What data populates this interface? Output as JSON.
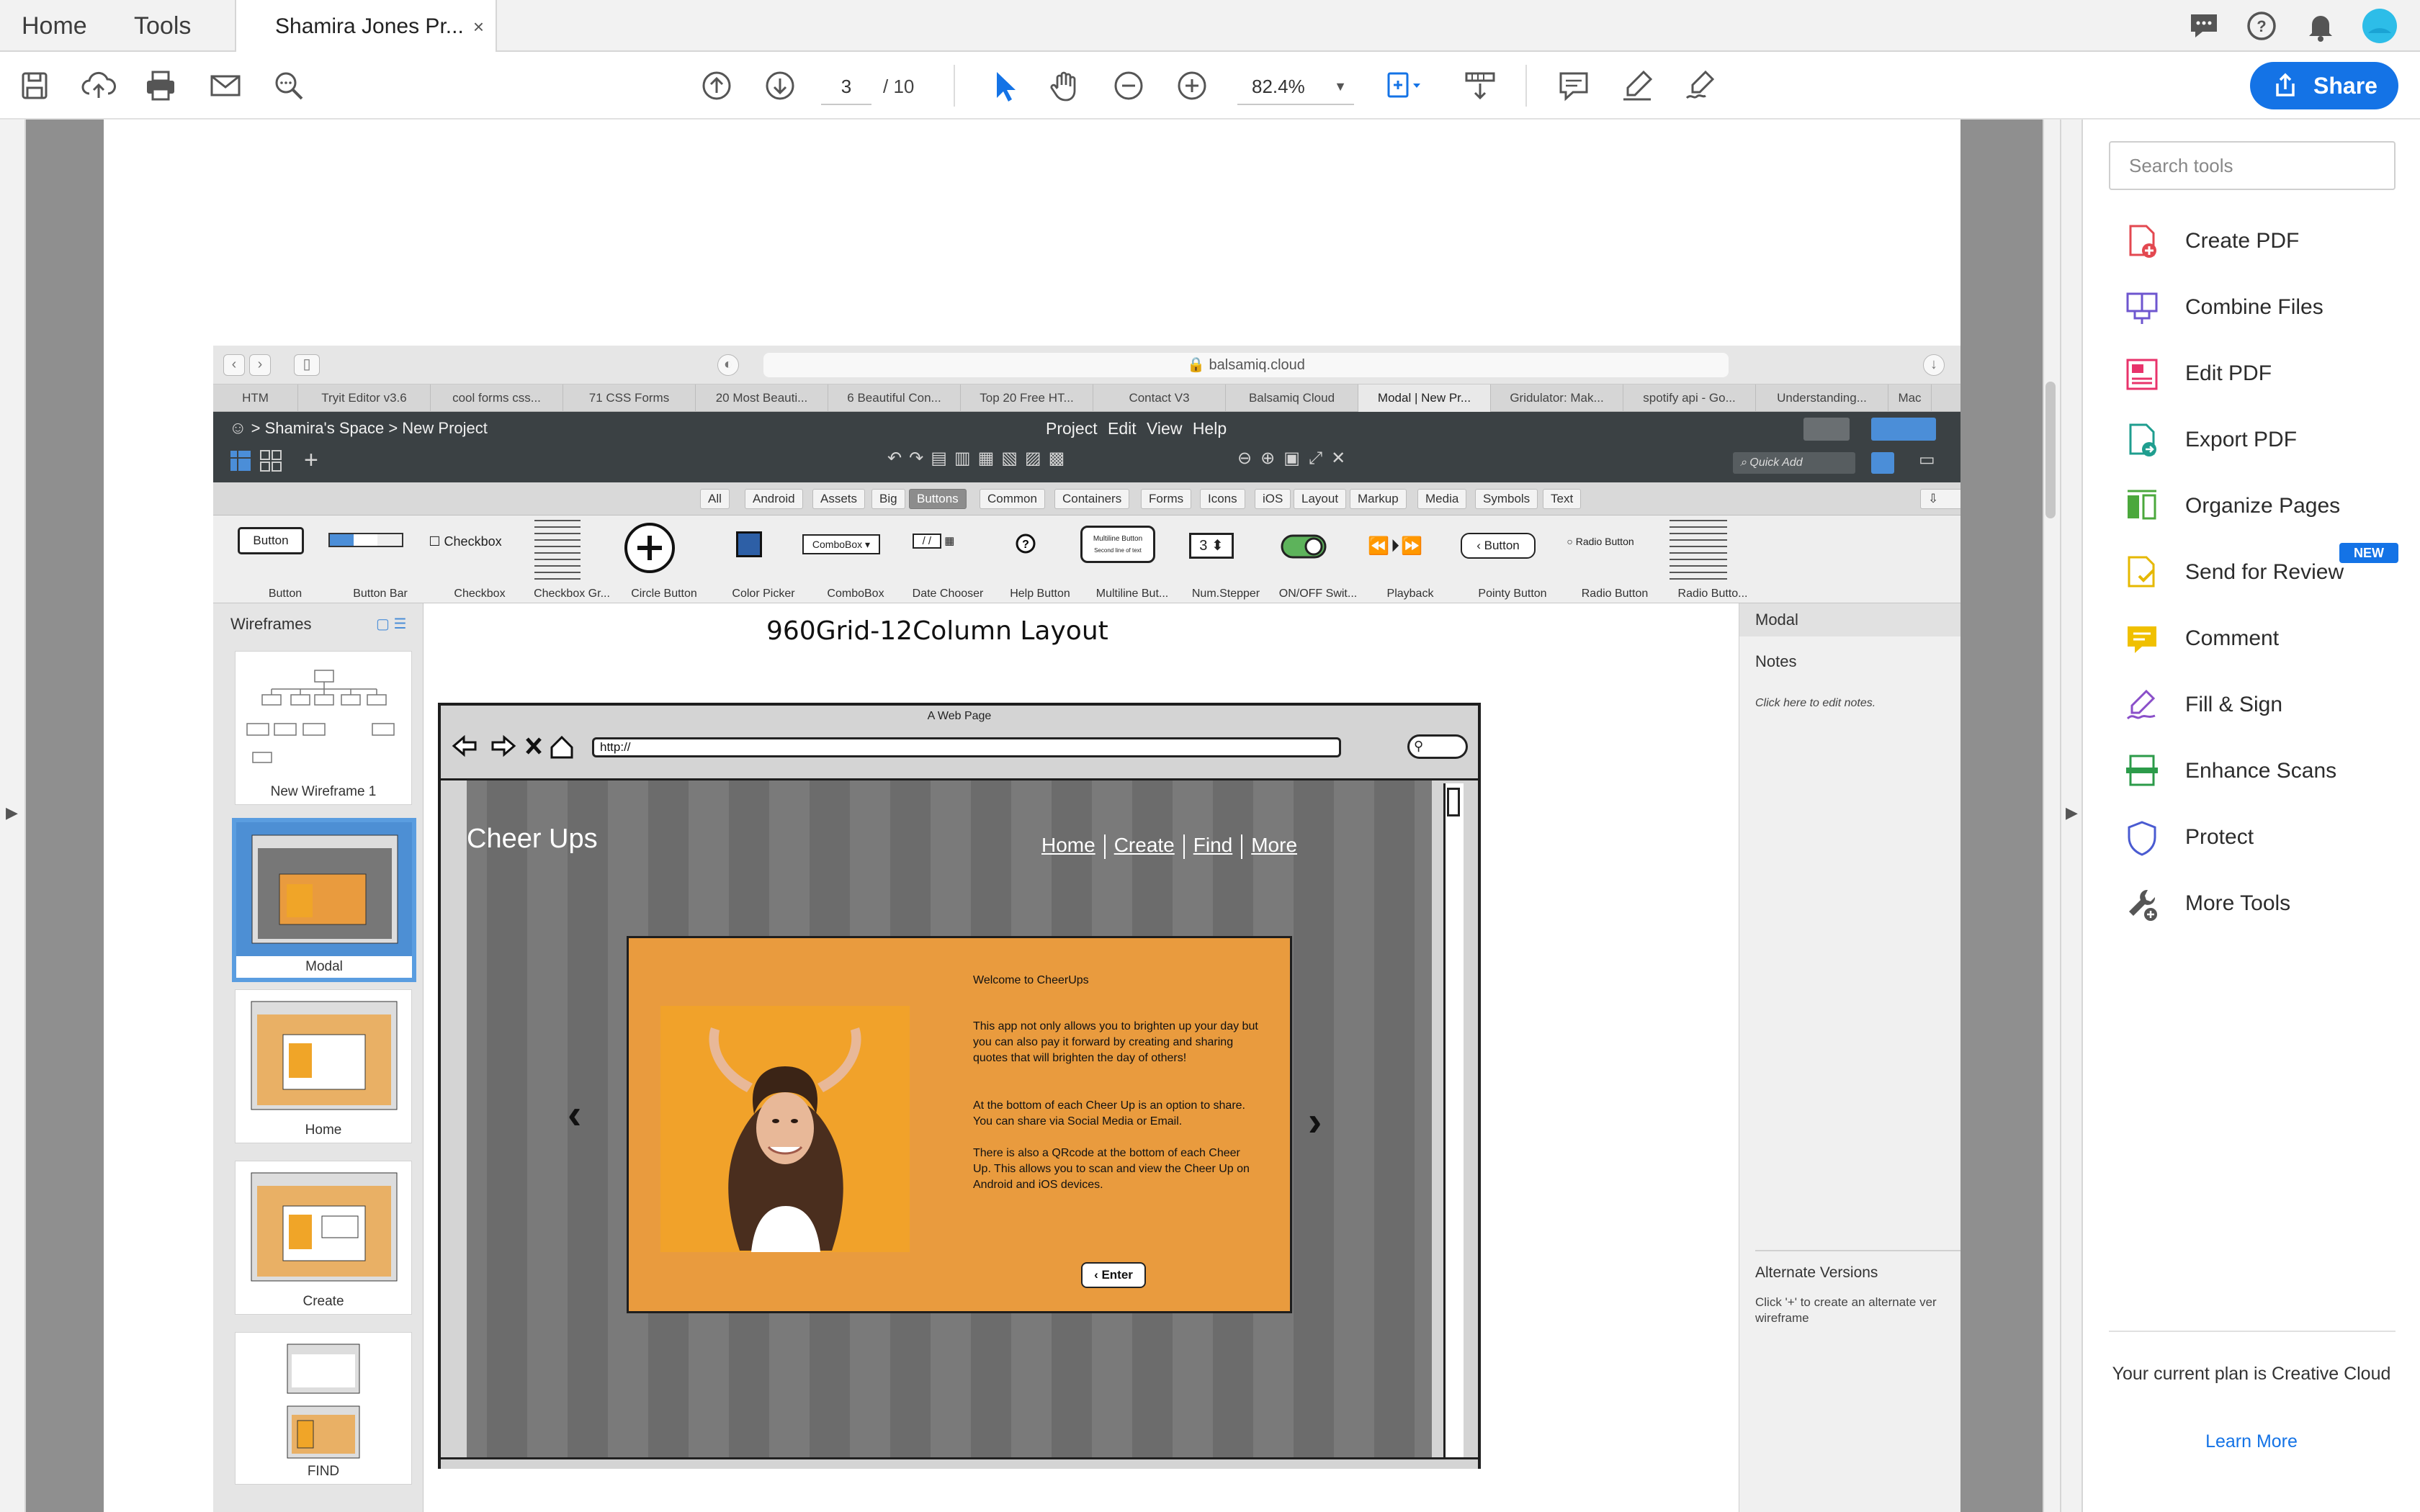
{
  "app": {
    "tabs": {
      "home": "Home",
      "tools": "Tools"
    },
    "document_tab": {
      "title": "Shamira Jones Pr...",
      "close": "×"
    },
    "header_icons": [
      "chat-icon",
      "help-icon",
      "bell-icon",
      "profile-avatar"
    ]
  },
  "toolbar": {
    "page_current": "3",
    "page_total": "/ 10",
    "zoom": "82.4%",
    "share_label": "Share"
  },
  "browser": {
    "url": "balsamiq.cloud",
    "tabs": [
      "HTM",
      "Tryit Editor v3.6",
      "cool forms css...",
      "71 CSS Forms",
      "20 Most Beauti...",
      "6 Beautiful Con...",
      "Top 20 Free HT...",
      "Contact V3",
      "Balsamiq Cloud",
      "Modal | New Pr...",
      "Gridulator: Mak...",
      "spotify api - Go...",
      "Understanding...",
      "Mac"
    ]
  },
  "balsamiq": {
    "breadcrumb": "> Shamira's Space > New Project",
    "menu": "Project Edit View Help",
    "quick_add": "Quick Add",
    "filters": [
      "All",
      "Android",
      "Assets",
      "Big",
      "Buttons",
      "Common",
      "Containers",
      "Forms",
      "Icons",
      "iOS",
      "Layout",
      "Markup",
      "Media",
      "Symbols",
      "Text"
    ],
    "filter_active": "Buttons",
    "library": [
      "Button",
      "Button Bar",
      "Checkbox",
      "Checkbox Gr...",
      "Circle Button",
      "Color Picker",
      "ComboBox",
      "Date Chooser",
      "Help Button",
      "Multiline But...",
      "Num.Stepper",
      "ON/OFF Swit...",
      "Playback",
      "Pointy Button",
      "Radio Button",
      "Radio Butto..."
    ],
    "library_widgets": {
      "button": "Button",
      "checkbox": "Checkbox",
      "combobox": "ComboBox",
      "date": "/ /",
      "multiline": "Multiline Button",
      "multiline_sub": "Second line of text",
      "stepper": "3",
      "pointy": "Button",
      "radio": "Radio Button"
    },
    "wireframes_header": "Wireframes",
    "wireframes": [
      "New Wireframe 1",
      "Modal",
      "Home",
      "Create",
      "FIND"
    ],
    "selected_wireframe": "Modal",
    "inspector": {
      "title": "Modal",
      "notes_title": "Notes",
      "notes_hint": "Click here to edit notes.",
      "alt_title": "Alternate Versions",
      "alt_text": "Click '+' to create an alternate ver wireframe"
    }
  },
  "mockup": {
    "title": "960Grid-12Column Layout",
    "window_title": "A Web Page",
    "url": "http://",
    "brand": "Cheer Ups",
    "nav": [
      "Home",
      "Create",
      "Find",
      "More"
    ],
    "modal": {
      "heading": "Welcome to CheerUps",
      "p1": "This app not only allows you to brighten up your day but you can also pay it forward by creating and sharing quotes that will brighten the day of others!",
      "p2": "At the bottom of each Cheer Up is an option to share. You can share via Social Media or Email.",
      "p3": "There is also a QRcode at the bottom of each Cheer Up. This allows you to scan and view the Cheer Up on Android and iOS devices.",
      "enter": "Enter"
    },
    "carousel": {
      "prev": "‹",
      "next": "›"
    }
  },
  "tools_pane": {
    "search_placeholder": "Search tools",
    "tools": [
      {
        "label": "Create PDF",
        "icon": "create-pdf-icon",
        "color": "#e34850"
      },
      {
        "label": "Combine Files",
        "icon": "combine-files-icon",
        "color": "#6e56cf"
      },
      {
        "label": "Edit PDF",
        "icon": "edit-pdf-icon",
        "color": "#e8336b"
      },
      {
        "label": "Export PDF",
        "icon": "export-pdf-icon",
        "color": "#1f9e8f"
      },
      {
        "label": "Organize Pages",
        "icon": "organize-pages-icon",
        "color": "#4ba83c"
      },
      {
        "label": "Send for Review",
        "icon": "send-for-review-icon",
        "color": "#e6b800"
      },
      {
        "label": "Comment",
        "icon": "comment-icon",
        "color": "#f0c000"
      },
      {
        "label": "Fill & Sign",
        "icon": "fill-sign-icon",
        "color": "#8a4fc9"
      },
      {
        "label": "Enhance Scans",
        "icon": "enhance-scans-icon",
        "color": "#2c9b4a"
      },
      {
        "label": "Protect",
        "icon": "protect-icon",
        "color": "#4a5bd1"
      },
      {
        "label": "More Tools",
        "icon": "more-tools-icon",
        "color": "#555555"
      }
    ],
    "new_badge": "NEW",
    "plan_text": "Your current plan is Creative Cloud",
    "learn_more": "Learn More"
  },
  "colors": {
    "accent": "#1473e6",
    "balsamiq_dark": "#3b4144",
    "modal_orange": "#e99b3e",
    "selected_thumb": "#4d8fd4"
  }
}
